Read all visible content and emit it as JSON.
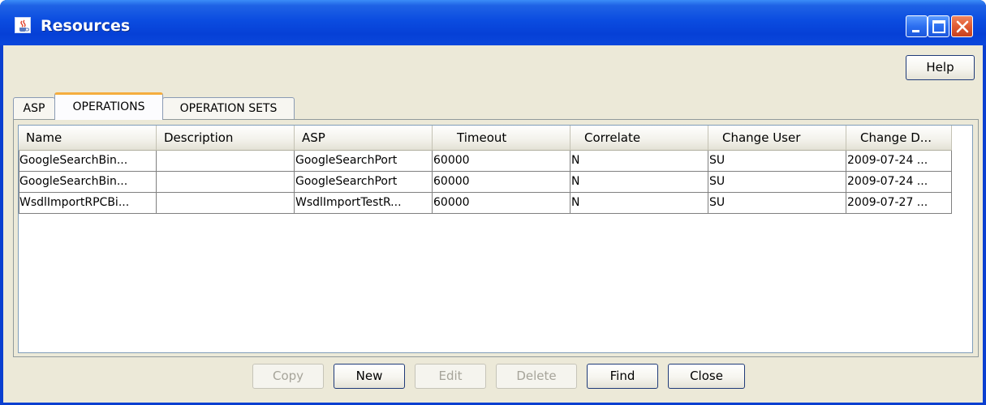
{
  "window": {
    "title": "Resources",
    "icon": "java-cup-icon",
    "accent": "#0a47dc",
    "controls": [
      "minimize-icon",
      "maximize-icon",
      "close-icon"
    ]
  },
  "toolbar": {
    "help_label": "Help"
  },
  "tabs": [
    {
      "label": "ASP",
      "active": false
    },
    {
      "label": "OPERATIONS",
      "active": true
    },
    {
      "label": "OPERATION SETS",
      "active": false
    }
  ],
  "table": {
    "columns": [
      "Name",
      "Description",
      "ASP",
      "Timeout",
      "Correlate",
      "Change User",
      "Change D..."
    ],
    "rows": [
      [
        "GoogleSearchBin...",
        "",
        "GoogleSearchPort",
        "60000",
        "N",
        "SU",
        "2009-07-24 ..."
      ],
      [
        "GoogleSearchBin...",
        "",
        "GoogleSearchPort",
        "60000",
        "N",
        "SU",
        "2009-07-24 ..."
      ],
      [
        "WsdlImportRPCBi...",
        "",
        "WsdlImportTestR...",
        "60000",
        "N",
        "SU",
        "2009-07-27 ..."
      ]
    ]
  },
  "actions": {
    "copy_label": "Copy",
    "new_label": "New",
    "edit_label": "Edit",
    "delete_label": "Delete",
    "find_label": "Find",
    "close_label": "Close"
  }
}
